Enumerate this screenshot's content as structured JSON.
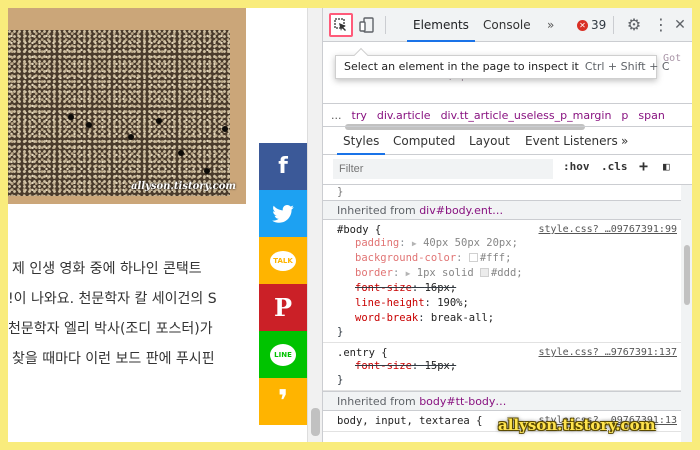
{
  "page": {
    "photo_watermark": "allyson.tistory.com",
    "paragraph_lines": [
      "제 인생 영화 중에 하나인 콘택트",
      "!이 나와요. 천문학자 칼 세이건의 S",
      "천문학자 엘리 박사(조디 포스터)가",
      "찾을 때마다 이런 보드 판에 푸시핀"
    ]
  },
  "share": [
    {
      "name": "facebook",
      "glyph": "f",
      "color": "#3b5998"
    },
    {
      "name": "twitter",
      "glyph": "🐦",
      "color": "#1da1f2"
    },
    {
      "name": "kakaotalk",
      "glyph": "TALK",
      "color": "#ffb400"
    },
    {
      "name": "pinterest",
      "glyph": "P",
      "color": "#cb2027"
    },
    {
      "name": "line",
      "glyph": "LINE",
      "color": "#00c300"
    },
    {
      "name": "kakaostory",
      "glyph": "❜",
      "color": "#ffb400"
    }
  ],
  "devtools": {
    "tabs": {
      "elements": "Elements",
      "console": "Console",
      "more": "»"
    },
    "error_count": "39",
    "tooltip": {
      "text": "Select an element in the page to inspect it",
      "shortcut": "Ctrl + Shift + C"
    },
    "dom_snippet_1": "um Got",
    "dom_snippet_2": "</span>",
    "breadcrumbs": [
      "...",
      "try",
      "div.article",
      "div.tt_article_useless_p_margin",
      "p",
      "span"
    ],
    "subtabs": {
      "styles": "Styles",
      "computed": "Computed",
      "layout": "Layout",
      "listeners": "Event Listeners",
      "more": "»"
    },
    "filter_placeholder": "Filter",
    "hov": ":hov",
    "cls": ".cls",
    "plus": "+",
    "inherited1": {
      "label": "Inherited from",
      "selector": "div#body.ent…"
    },
    "rule_body": {
      "selector": "#body {",
      "source": "style.css? …09767391:99",
      "decls": [
        {
          "name": "padding",
          "value": "40px 50px 20px;"
        },
        {
          "name": "background-color",
          "value": "#fff;"
        },
        {
          "name": "border",
          "value": "1px solid",
          "value2": "#ddd;"
        },
        {
          "name": "font-size",
          "value": "16px;"
        },
        {
          "name": "line-height",
          "value": "190%;"
        },
        {
          "name": "word-break",
          "value": "break-all;"
        }
      ],
      "close": "}"
    },
    "rule_entry": {
      "selector": ".entry {",
      "source": "style.css? …9767391:137",
      "decl": {
        "name": "font-size",
        "value": "15px;"
      },
      "close": "}"
    },
    "inherited2": {
      "label": "Inherited from",
      "selector": "body#tt-body…"
    },
    "rule_inputs": {
      "selector": "body, input, textarea {",
      "source": "style.css? …09767391:13"
    }
  },
  "watermark": "allyson.tistory.com",
  "colors": {
    "highlight": "#ff5b7a",
    "accent": "#1a73e8",
    "frame": "#f9ec7c"
  }
}
